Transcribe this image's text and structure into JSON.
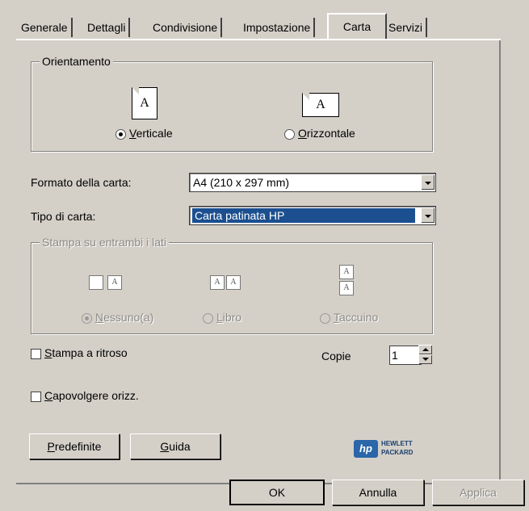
{
  "tabs": [
    {
      "label": "Generale"
    },
    {
      "label": "Dettagli"
    },
    {
      "label": "Condivisione"
    },
    {
      "label": "Impostazione"
    },
    {
      "label": "Carta"
    },
    {
      "label": "Servizi"
    }
  ],
  "active_tab": "Carta",
  "orientation": {
    "legend": "Orientamento",
    "page_letter": "A",
    "portrait": {
      "first": "V",
      "rest": "erticale",
      "checked": true
    },
    "landscape": {
      "first": "O",
      "rest": "rizzontale",
      "checked": false
    }
  },
  "paper_size": {
    "label": "Formato della carta:",
    "value": "A4 (210 x 297 mm)"
  },
  "paper_type": {
    "label": "Tipo di carta:",
    "value": "Carta patinata HP"
  },
  "duplex": {
    "legend": "Stampa su entrambi i lati",
    "none": {
      "first": "N",
      "rest": "essuno(a)",
      "checked": true
    },
    "book": {
      "first": "L",
      "rest": "ibro",
      "checked": false
    },
    "notepad": {
      "first": "T",
      "rest": "accuino",
      "checked": false
    }
  },
  "reverse_print": {
    "first": "S",
    "rest": "tampa a ritroso",
    "checked": false
  },
  "flip_horizontal": {
    "first": "C",
    "rest": "apovolgere orizz.",
    "checked": false
  },
  "copies": {
    "label": "Copie",
    "value": "1"
  },
  "buttons": {
    "defaults": {
      "first": "P",
      "rest": "redefinite"
    },
    "help": {
      "first": "G",
      "rest": "uida"
    },
    "ok": "OK",
    "cancel": "Annulla",
    "apply": "Applica"
  },
  "brand": {
    "mark": "hp",
    "line1": "HEWLETT",
    "line2": "PACKARD",
    "color": "#2a66a8"
  },
  "colors": {
    "face": "#d4d0c8",
    "selection": "#1b4f8f"
  }
}
